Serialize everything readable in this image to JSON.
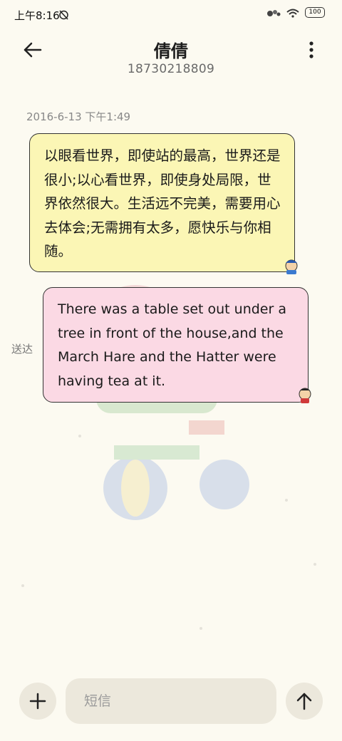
{
  "status_bar": {
    "time": "上午8:16",
    "battery": "100"
  },
  "header": {
    "contact_name": "倩倩",
    "contact_number": "18730218809"
  },
  "conversation": {
    "timestamp": "2016-6-13 下午1:49",
    "messages": [
      {
        "direction": "incoming",
        "text": "以眼看世界，即使站的最高，世界还是很小;以心看世界，即使身处局限，世界依然很大。生活远不完美，需要用心去体会;无需拥有太多，愿快乐与你相随。"
      },
      {
        "direction": "outgoing",
        "text": "There was a table set out under a tree in front of the house,and the March Hare and the Hatter were having tea at it.",
        "status": "送达"
      }
    ]
  },
  "composer": {
    "placeholder": "短信"
  },
  "icons": {
    "back": "arrow-left-icon",
    "more": "more-vertical-icon",
    "add": "plus-icon",
    "send": "arrow-up-icon"
  }
}
